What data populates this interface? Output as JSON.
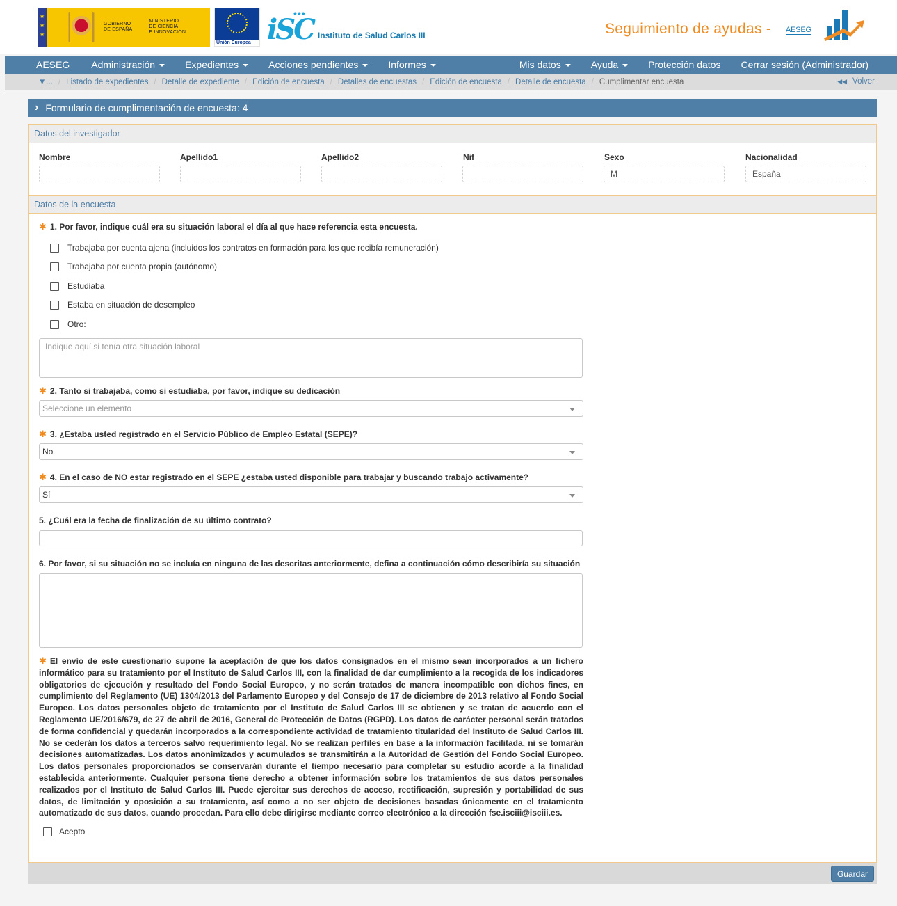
{
  "header": {
    "gobierno_text": "GOBIERNO\nDE ESPAÑA",
    "ministerio_text": "MINISTERIO\nDE CIENCIA\nE INNOVACIÓN",
    "eu_label": "Unión Europea",
    "isc_mark": "iSC",
    "isc_name": "Instituto de Salud Carlos III",
    "app_title": "Seguimiento de ayudas -",
    "app_badge": "AESEG"
  },
  "nav": {
    "items": [
      {
        "label": "AESEG",
        "dropdown": false
      },
      {
        "label": "Administración",
        "dropdown": true
      },
      {
        "label": "Expedientes",
        "dropdown": true
      },
      {
        "label": "Acciones pendientes",
        "dropdown": true
      },
      {
        "label": "Informes",
        "dropdown": true
      }
    ],
    "right_items": [
      {
        "label": "Mis datos",
        "dropdown": true
      },
      {
        "label": "Ayuda",
        "dropdown": true
      },
      {
        "label": "Protección datos",
        "dropdown": false
      },
      {
        "label": "Cerrar sesión (Administrador)",
        "dropdown": false
      }
    ]
  },
  "breadcrumb": {
    "root": "▼...",
    "items": [
      "Listado de expedientes",
      "Detalle de expediente",
      "Edición de encuesta",
      "Detalles de encuestas",
      "Edición de encuesta",
      "Detalle de encuesta"
    ],
    "active": "Cumplimentar encuesta",
    "back": "Volver",
    "back_icon": "◀◀"
  },
  "form": {
    "title": "Formulario de cumplimentación de encuesta: 4",
    "investigator_section": "Datos del investigador",
    "fields": [
      {
        "label": "Nombre",
        "value": ""
      },
      {
        "label": "Apellido1",
        "value": ""
      },
      {
        "label": "Apellido2",
        "value": ""
      },
      {
        "label": "Nif",
        "value": ""
      },
      {
        "label": "Sexo",
        "value": "M"
      },
      {
        "label": "Nacionalidad",
        "value": "España"
      }
    ],
    "survey_section": "Datos de la encuesta",
    "required_mark": "✱",
    "q1": {
      "text": "1. Por favor, indique cuál era su situación laboral el día al que hace referencia esta encuesta.",
      "options": [
        "Trabajaba por cuenta ajena (incluidos los contratos en formación para los que recibía remuneración)",
        "Trabajaba por cuenta propia (autónomo)",
        "Estudiaba",
        "Estaba en situación de desempleo",
        "Otro:"
      ],
      "other_placeholder": "Indique aquí si tenía otra situación laboral"
    },
    "q2": {
      "text": "2. Tanto si trabajaba, como si estudiaba, por favor, indique su dedicación",
      "value": "Seleccione un elemento"
    },
    "q3": {
      "text": "3. ¿Estaba usted registrado en el Servicio Público de Empleo Estatal (SEPE)?",
      "value": "No"
    },
    "q4": {
      "text": "4. En el caso de NO estar registrado en el SEPE ¿estaba usted disponible para trabajar y buscando trabajo activamente?",
      "value": "Sí"
    },
    "q5": {
      "text": "5. ¿Cuál era la fecha de finalización de su último contrato?",
      "value": ""
    },
    "q6": {
      "text": "6. Por favor, si su situación no se incluía en ninguna de las descritas anteriormente, defina a continuación cómo describiría su situación",
      "value": ""
    },
    "legal_text": "El envío de este cuestionario supone la aceptación de que los datos consignados en el mismo sean incorporados a un fichero informático para su tratamiento por el Instituto de Salud Carlos III, con la finalidad de dar cumplimiento a la recogida de los indicadores obligatorios de ejecución y resultado del Fondo Social Europeo, y no serán tratados de manera incompatible con dichos fines, en cumplimiento del Reglamento (UE) 1304/2013 del Parlamento Europeo y del Consejo de 17 de diciembre de 2013 relativo al Fondo Social Europeo. Los datos personales objeto de tratamiento por el Instituto de Salud Carlos III se obtienen y se tratan de acuerdo con el Reglamento UE/2016/679, de 27 de abril de 2016, General de Protección de Datos (RGPD). Los datos de carácter personal serán tratados de forma confidencial y quedarán incorporados a la correspondiente actividad de tratamiento titularidad del Instituto de Salud Carlos III. No se cederán los datos a terceros salvo requerimiento legal. No se realizan perfiles en base a la información facilitada, ni se tomarán decisiones automatizadas. Los datos anonimizados y acumulados se transmitirán a la Autoridad de Gestión del Fondo Social Europeo. Los datos personales proporcionados se conservarán durante el tiempo necesario para completar su estudio acorde a la finalidad establecida anteriormente. Cualquier persona tiene derecho a obtener información sobre los tratamientos de sus datos personales realizados por el Instituto de Salud Carlos III. Puede ejercitar sus derechos de acceso, rectificación, supresión y portabilidad de sus datos, de limitación y oposición a su tratamiento, así como a no ser objeto de decisiones basadas únicamente en el tratamiento automatizado de sus datos, cuando procedan. Para ello debe dirigirse mediante correo electrónico a la dirección fse.isciii@isciii.es.",
    "accept_label": "Acepto",
    "save_label": "Guardar"
  },
  "colors": {
    "nav_bg": "#4f7fa7",
    "accent_orange": "#ef8c23",
    "panel_border": "#f2c98c",
    "required": "#f18a1f"
  }
}
